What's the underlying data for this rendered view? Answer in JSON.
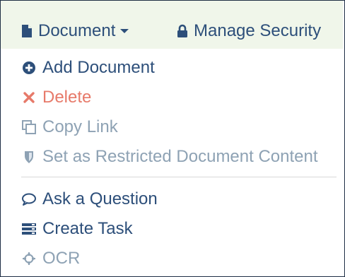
{
  "toolbar": {
    "document_label": "Document",
    "manage_security_label": "Manage Security"
  },
  "menu": {
    "items": [
      {
        "label": "Add Document",
        "icon": "plus-circle-icon",
        "color": "#2d4f7a",
        "state": "enabled"
      },
      {
        "label": "Delete",
        "icon": "x-icon",
        "color": "#e77a6a",
        "state": "enabled"
      },
      {
        "label": "Copy Link",
        "icon": "copy-icon",
        "color": "#8ea2b4",
        "state": "disabled"
      },
      {
        "label": "Set as Restricted Document Content",
        "icon": "shield-icon",
        "color": "#8ea2b4",
        "state": "disabled"
      },
      {
        "label": "Ask a Question",
        "icon": "speech-bubble-icon",
        "color": "#2d4f7a",
        "state": "enabled"
      },
      {
        "label": "Create Task",
        "icon": "task-list-icon",
        "color": "#2d4f7a",
        "state": "enabled"
      },
      {
        "label": "OCR",
        "icon": "crosshair-icon",
        "color": "#8ea2b4",
        "state": "disabled"
      }
    ]
  },
  "colors": {
    "header_bg": "#f0f6ea",
    "text_primary": "#2d4f7a",
    "text_danger": "#e77a6a",
    "text_disabled": "#8ea2b4",
    "divider": "#d8d8d8"
  }
}
